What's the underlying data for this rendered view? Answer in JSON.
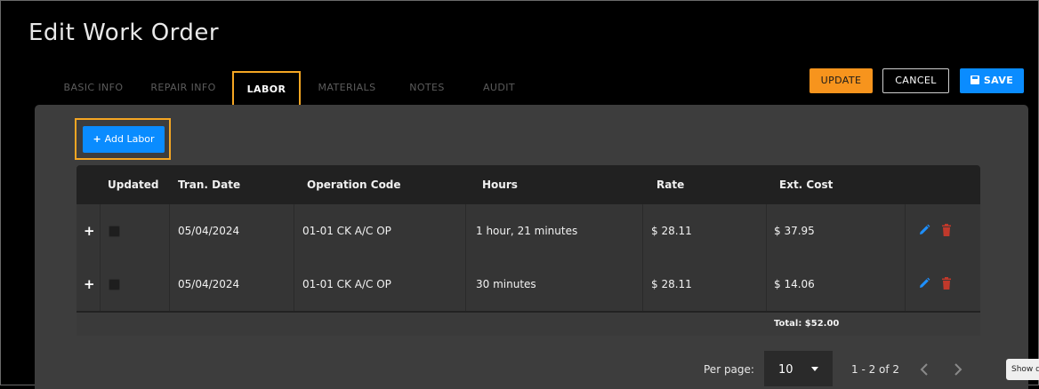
{
  "page": {
    "title": "Edit Work Order"
  },
  "tabs": [
    {
      "label": "BASIC INFO"
    },
    {
      "label": "REPAIR INFO"
    },
    {
      "label": "LABOR"
    },
    {
      "label": "MATERIALS"
    },
    {
      "label": "NOTES"
    },
    {
      "label": "AUDIT"
    }
  ],
  "actions": {
    "update": "UPDATE",
    "cancel": "CANCEL",
    "save": "SAVE"
  },
  "labor": {
    "add_label": "Add Labor",
    "columns": [
      "Updated",
      "Tran. Date",
      "Operation Code",
      "Hours",
      "Rate",
      "Ext. Cost"
    ],
    "rows": [
      {
        "updated": false,
        "tran_date": "05/04/2024",
        "operation_code": "01-01 CK A/C OP",
        "hours": "1 hour, 21 minutes",
        "rate": "$ 28.11",
        "ext_cost": "$ 37.95"
      },
      {
        "updated": false,
        "tran_date": "05/04/2024",
        "operation_code": "01-01 CK A/C OP",
        "hours": "30 minutes",
        "rate": "$ 28.11",
        "ext_cost": "$ 14.06"
      }
    ],
    "total": "Total: $52.00"
  },
  "pagination": {
    "per_page_label": "Per page:",
    "per_page_value": "10",
    "range": "1 - 2 of 2"
  },
  "tooltip": {
    "text": "Show d"
  },
  "colors": {
    "accent_orange": "#f7941d",
    "primary_blue": "#0a8cff",
    "highlight": "#f5a623",
    "delete_red": "#c0392b"
  }
}
